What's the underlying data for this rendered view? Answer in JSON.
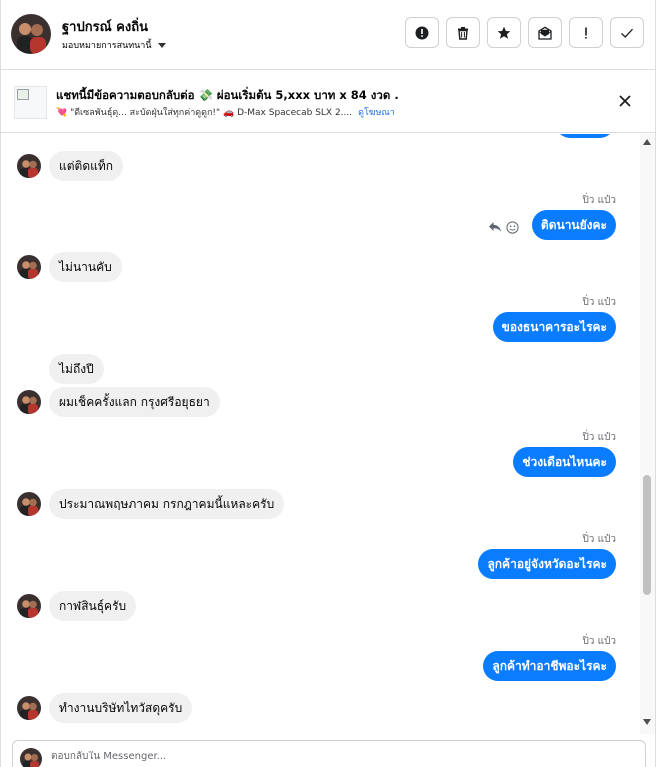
{
  "header": {
    "contact_name": "ฐาปกรณ์ คงถิ่น",
    "assign_label": "มอบหมายการสนทนานี้",
    "actions": [
      {
        "name": "report-button",
        "icon": "alert-circle-icon"
      },
      {
        "name": "delete-button",
        "icon": "trash-icon"
      },
      {
        "name": "star-button",
        "icon": "star-icon"
      },
      {
        "name": "mark-unread-button",
        "icon": "mail-open-icon"
      },
      {
        "name": "spam-button",
        "icon": "exclamation-icon"
      },
      {
        "name": "done-button",
        "icon": "check-icon"
      }
    ]
  },
  "ad": {
    "title": "แชทนี้มีข้อความตอบกลับต่อ 💸 ผ่อนเริ่มต้น 5,xxx บาท x 84 งวด .",
    "subtitle": "💘 \"ดีเซลพันธุ์ดุ... สะบัดฝุ่นใส่ทุกค่าดูดูก!\" 🚗 D-Max Spacecab SLX 2....",
    "link": "ดูโฆษณา"
  },
  "conversation": {
    "sender_out": "ปิ่ว แป๋ว",
    "messages": [
      {
        "dir": "in",
        "text": "แต่ติดแท็ก"
      },
      {
        "dir": "out",
        "text": "ติดนานยังคะ"
      },
      {
        "dir": "in",
        "text": "ไม่นานคับ"
      },
      {
        "dir": "out",
        "text": "ของธนาคารอะไรคะ"
      },
      {
        "dir": "in",
        "text": "ไม่ถึงปี"
      },
      {
        "dir": "in",
        "text": "ผมเช็คครั้งแลก กรุงศรีอยุธยา"
      },
      {
        "dir": "out",
        "text": "ช่วงเดือนไหนคะ"
      },
      {
        "dir": "in",
        "text": "ประมาณพฤษภาคม กรกฎาคมนี้แหละครับ"
      },
      {
        "dir": "out",
        "text": "ลูกค้าอยู่จังหวัดอะไรคะ"
      },
      {
        "dir": "in",
        "text": "กาฬสินธุ์ครับ"
      },
      {
        "dir": "out",
        "text": "ลูกค้าทำอาชีพอะไรคะ"
      },
      {
        "dir": "in",
        "text": "ทำงานบริษัทไทวัสดุครับ"
      }
    ]
  },
  "reply": {
    "placeholder": "ตอบกลับใน Messenger..."
  },
  "colors": {
    "outgoing_bubble": "#0a7cff",
    "incoming_bubble": "#f0f0f0"
  }
}
